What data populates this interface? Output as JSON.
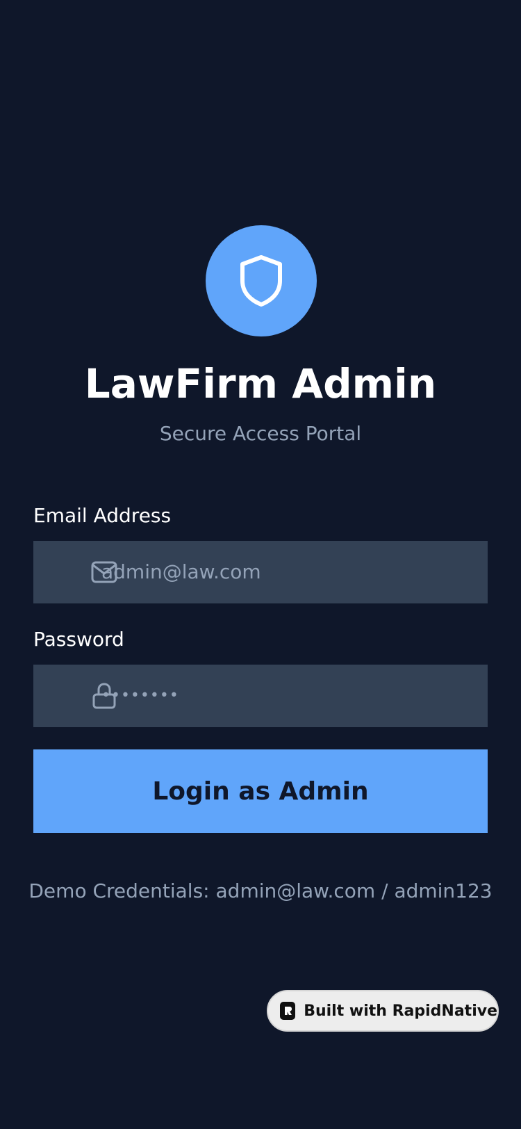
{
  "header": {
    "logo_icon": "shield-icon",
    "title": "LawFirm Admin",
    "subtitle": "Secure Access Portal"
  },
  "form": {
    "email": {
      "label": "Email Address",
      "icon": "mail-icon",
      "placeholder": "admin@law.com"
    },
    "password": {
      "label": "Password",
      "icon": "lock-icon",
      "masked_value": "••••••••"
    },
    "submit_label": "Login as Admin"
  },
  "demo_credentials": "Demo Credentials: admin@law.com / admin123",
  "badge": {
    "icon": "rapidnative-logo-icon",
    "label": "Built with RapidNative"
  },
  "colors": {
    "background": "#0f172a",
    "accent": "#60a5fa",
    "input_background": "#334155",
    "muted_text": "#94a3b8"
  }
}
